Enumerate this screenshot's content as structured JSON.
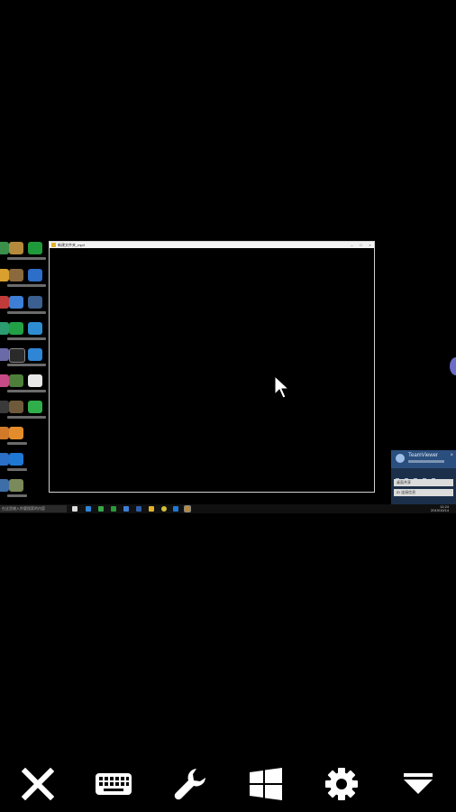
{
  "window": {
    "title": "新建文件夹_mp4",
    "min": "–",
    "max": "□",
    "close": "×"
  },
  "teamviewer": {
    "title": "TeamViewer",
    "row1": "桌面共享",
    "row2": "ID 连接信息"
  },
  "taskbar": {
    "search_placeholder": "在这里输入你要搜索的内容",
    "time": "11:24",
    "date": "2019/10/14"
  },
  "toolbar": {
    "close": "close-icon",
    "keyboard": "keyboard-icon",
    "tools": "wrench-icon",
    "windows": "windows-icon",
    "settings": "gear-icon",
    "collapse": "collapse-icon"
  },
  "colors": {
    "background": "#000000",
    "toolbar_icon": "#ffffff",
    "teamviewer": "#2a4f7e"
  }
}
